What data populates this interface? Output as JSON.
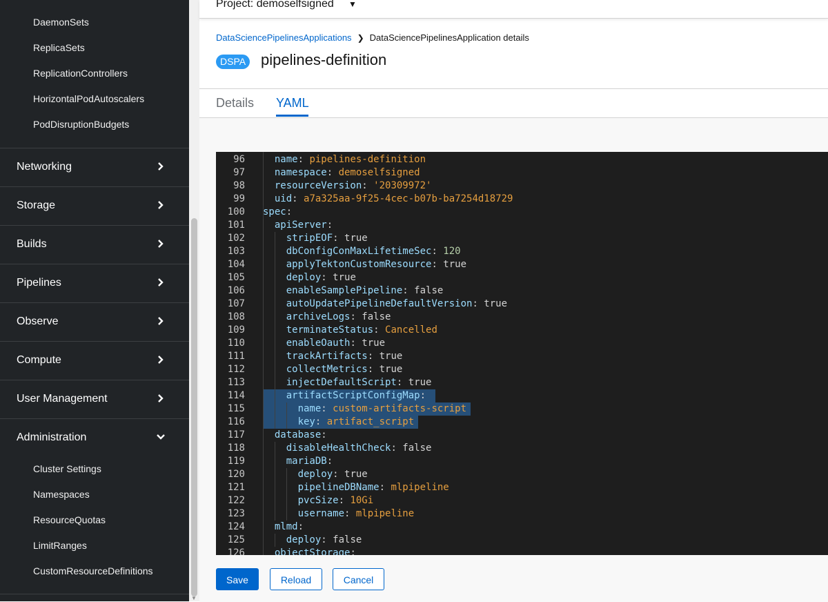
{
  "sidebar": {
    "workload_items": [
      "DaemonSets",
      "ReplicaSets",
      "ReplicationControllers",
      "HorizontalPodAutoscalers",
      "PodDisruptionBudgets"
    ],
    "sections": [
      "Networking",
      "Storage",
      "Builds",
      "Pipelines",
      "Observe",
      "Compute",
      "User Management",
      "Administration"
    ],
    "admin_items": [
      "Cluster Settings",
      "Namespaces",
      "ResourceQuotas",
      "LimitRanges",
      "CustomResourceDefinitions"
    ]
  },
  "header": {
    "project_label": "Project: demoselfsigned"
  },
  "breadcrumb": {
    "parent": "DataSciencePipelinesApplications",
    "current": "DataSciencePipelinesApplication details"
  },
  "title": {
    "badge": "DSPA",
    "name": "pipelines-definition"
  },
  "tabs": [
    "Details",
    "YAML"
  ],
  "editor": {
    "lines": [
      {
        "n": "96",
        "i": 1,
        "k": "name",
        "v": "pipelines-definition",
        "t": "o"
      },
      {
        "n": "97",
        "i": 1,
        "k": "namespace",
        "v": "demoselfsigned",
        "t": "o"
      },
      {
        "n": "98",
        "i": 1,
        "k": "resourceVersion",
        "v": "'20309972'",
        "t": "o"
      },
      {
        "n": "99",
        "i": 1,
        "k": "uid",
        "v": "a7a325aa-9f25-4cec-b07b-ba7254d18729",
        "t": "o"
      },
      {
        "n": "100",
        "i": 0,
        "k": "spec",
        "v": "",
        "t": "p"
      },
      {
        "n": "101",
        "i": 1,
        "k": "apiServer",
        "v": "",
        "t": "p"
      },
      {
        "n": "102",
        "i": 2,
        "k": "stripEOF",
        "v": "true",
        "t": "b"
      },
      {
        "n": "103",
        "i": 2,
        "k": "dbConfigConMaxLifetimeSec",
        "v": "120",
        "t": "n"
      },
      {
        "n": "104",
        "i": 2,
        "k": "applyTektonCustomResource",
        "v": "true",
        "t": "b"
      },
      {
        "n": "105",
        "i": 2,
        "k": "deploy",
        "v": "true",
        "t": "b"
      },
      {
        "n": "106",
        "i": 2,
        "k": "enableSamplePipeline",
        "v": "false",
        "t": "b"
      },
      {
        "n": "107",
        "i": 2,
        "k": "autoUpdatePipelineDefaultVersion",
        "v": "true",
        "t": "b"
      },
      {
        "n": "108",
        "i": 2,
        "k": "archiveLogs",
        "v": "false",
        "t": "b"
      },
      {
        "n": "109",
        "i": 2,
        "k": "terminateStatus",
        "v": "Cancelled",
        "t": "o"
      },
      {
        "n": "110",
        "i": 2,
        "k": "enableOauth",
        "v": "true",
        "t": "b"
      },
      {
        "n": "111",
        "i": 2,
        "k": "trackArtifacts",
        "v": "true",
        "t": "b"
      },
      {
        "n": "112",
        "i": 2,
        "k": "collectMetrics",
        "v": "true",
        "t": "b"
      },
      {
        "n": "113",
        "i": 2,
        "k": "injectDefaultScript",
        "v": "true",
        "t": "b"
      },
      {
        "n": "114",
        "i": 2,
        "k": "artifactScriptConfigMap",
        "v": "",
        "t": "p"
      },
      {
        "n": "115",
        "i": 3,
        "k": "name",
        "v": "custom-artifacts-script",
        "t": "o"
      },
      {
        "n": "116",
        "i": 3,
        "k": "key",
        "v": "artifact_script",
        "t": "o"
      },
      {
        "n": "117",
        "i": 1,
        "k": "database",
        "v": "",
        "t": "p"
      },
      {
        "n": "118",
        "i": 2,
        "k": "disableHealthCheck",
        "v": "false",
        "t": "b"
      },
      {
        "n": "119",
        "i": 2,
        "k": "mariaDB",
        "v": "",
        "t": "p"
      },
      {
        "n": "120",
        "i": 3,
        "k": "deploy",
        "v": "true",
        "t": "b"
      },
      {
        "n": "121",
        "i": 3,
        "k": "pipelineDBName",
        "v": "mlpipeline",
        "t": "o"
      },
      {
        "n": "122",
        "i": 3,
        "k": "pvcSize",
        "v": "10Gi",
        "t": "o"
      },
      {
        "n": "123",
        "i": 3,
        "k": "username",
        "v": "mlpipeline",
        "t": "o"
      },
      {
        "n": "124",
        "i": 1,
        "k": "mlmd",
        "v": "",
        "t": "p"
      },
      {
        "n": "125",
        "i": 2,
        "k": "deploy",
        "v": "false",
        "t": "b"
      },
      {
        "n": "126",
        "i": 1,
        "k": "objectStorage",
        "v": "",
        "t": "p"
      }
    ]
  },
  "buttons": {
    "save": "Save",
    "reload": "Reload",
    "cancel": "Cancel"
  }
}
